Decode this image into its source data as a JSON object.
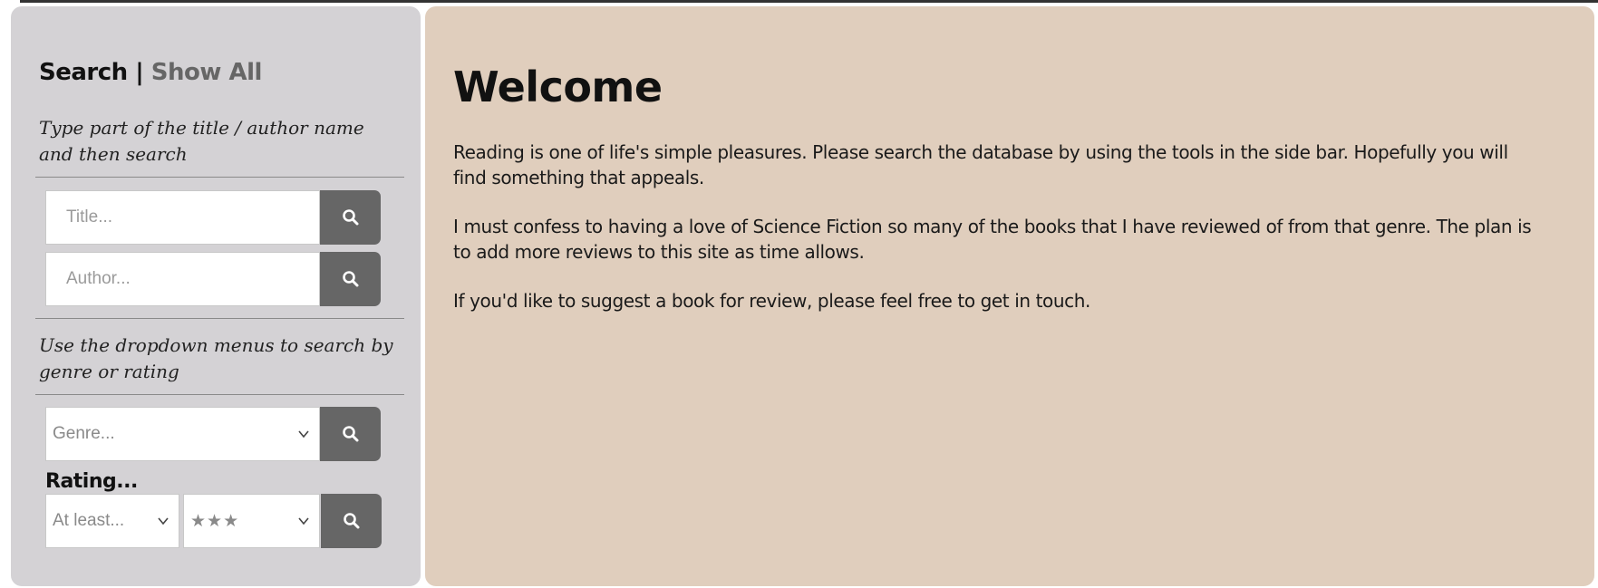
{
  "sidebar": {
    "search_label": "Search",
    "separator": "|",
    "show_all_label": "Show All",
    "text_search_hint": "Type part of the title / author name and then search",
    "title_placeholder": "Title...",
    "author_placeholder": "Author...",
    "dropdown_hint": "Use the dropdown menus to search by genre or rating",
    "genre_selected": "Genre...",
    "rating_label": "Rating...",
    "rating_comparator_selected": "At least...",
    "rating_stars_selected": "★★★",
    "button_icon": "search-icon",
    "button_color": "#666666",
    "background_color": "#d4d2d5"
  },
  "main": {
    "heading": "Welcome",
    "paragraphs": [
      "Reading is one of life's simple pleasures. Please search the database by using the tools in the side bar. Hopefully you will find something that appeals.",
      "I must confess to having a love of Science Fiction so many of the books that I have reviewed of from that genre. The plan is to add more reviews to this site as time allows.",
      "If you'd like to suggest a book for review, please feel free to get in touch."
    ],
    "background_color": "#e0cebd"
  }
}
